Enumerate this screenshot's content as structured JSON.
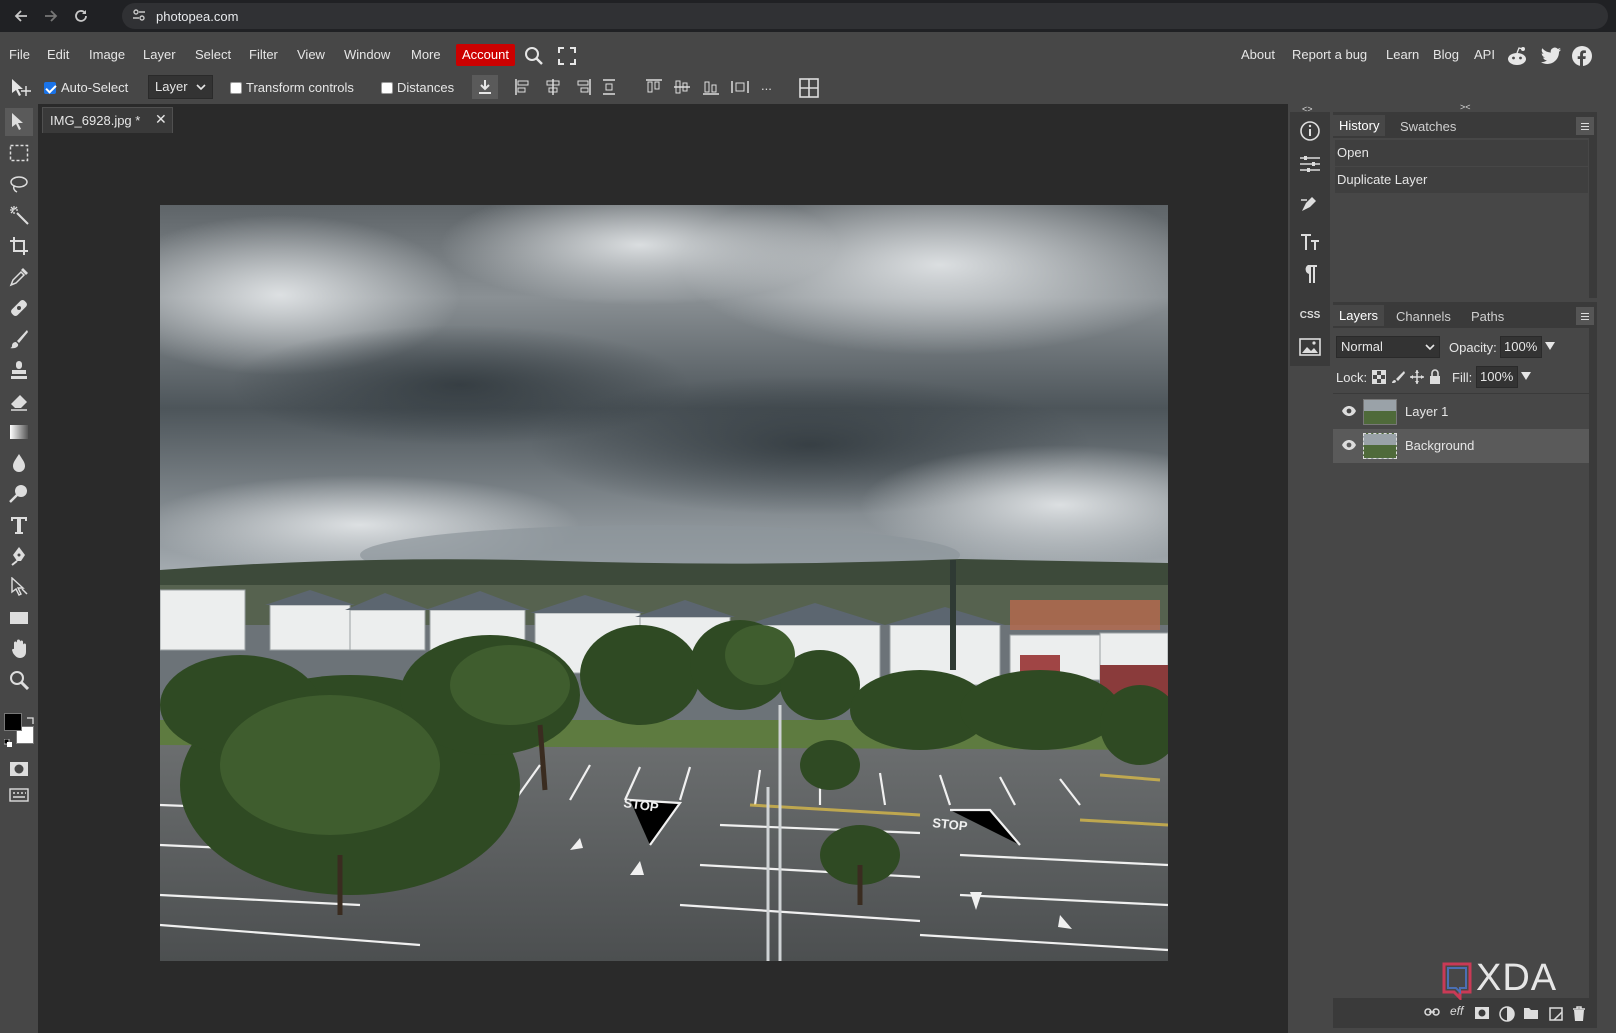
{
  "browser": {
    "url": "photopea.com"
  },
  "menu": {
    "items": [
      "File",
      "Edit",
      "Image",
      "Layer",
      "Select",
      "Filter",
      "View",
      "Window",
      "More"
    ],
    "account": "Account",
    "right": [
      "About",
      "Report a bug",
      "Learn",
      "Blog",
      "API"
    ]
  },
  "options": {
    "auto_select_label": "Auto-Select",
    "auto_select_checked": true,
    "layer_select": "Layer",
    "transform_label": "Transform controls",
    "distances_label": "Distances",
    "more": "..."
  },
  "document": {
    "tab_title": "IMG_6928.jpg *",
    "close": "✕"
  },
  "history_panel": {
    "tabs": [
      "History",
      "Swatches"
    ],
    "items": [
      "Open",
      "Duplicate Layer"
    ]
  },
  "layers_panel": {
    "tabs": [
      "Layers",
      "Channels",
      "Paths"
    ],
    "blend_mode": "Normal",
    "opacity_label": "Opacity:",
    "opacity_value": "100%",
    "lock_label": "Lock:",
    "fill_label": "Fill:",
    "fill_value": "100%",
    "layers": [
      {
        "name": "Layer 1",
        "visible": true,
        "selected": false
      },
      {
        "name": "Background",
        "visible": true,
        "selected": true
      }
    ]
  },
  "right_strip": {
    "css_label": "CSS"
  },
  "watermark": "XDA",
  "colors": {
    "accent": "#cc0000",
    "foreground": "#000000",
    "background": "#ffffff"
  }
}
